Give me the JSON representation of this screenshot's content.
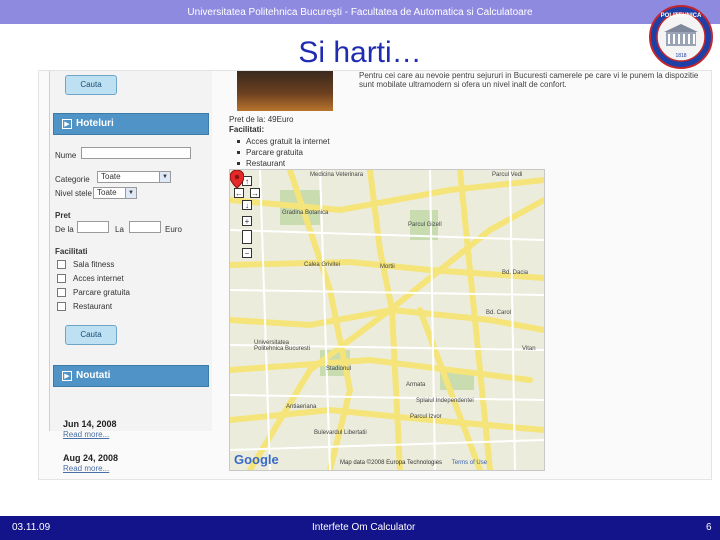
{
  "slide": {
    "header_text": "Universitatea Politehnica Bucureşti - Facultatea de Automatica si Calculatoare",
    "title": "Si harti…",
    "logo_text_top": "POLITEHNICA",
    "logo_year": "1818",
    "footer_date": "03.11.09",
    "footer_center": "Interfete Om Calculator",
    "footer_page": "6"
  },
  "sidebar": {
    "search_button_top": "Cauta",
    "hotels_panel_title": "Hoteluri",
    "name_label": "Nume",
    "category_label": "Categorie",
    "category_value": "Toate",
    "level_label": "Nivel stele",
    "level_value": "Toate",
    "price_heading": "Pret",
    "price_from_label": "De la",
    "price_to_label": "La",
    "price_currency": "Euro",
    "facilities_heading": "Facilitati",
    "facilities": [
      "Sala fitness",
      "Acces internet",
      "Parcare gratuita",
      "Restaurant"
    ],
    "search_button": "Cauta",
    "news_panel_title": "Noutati",
    "news": [
      {
        "date": "Jun 14, 2008",
        "link": "Read more..."
      },
      {
        "date": "Aug 24, 2008",
        "link": "Read more..."
      }
    ]
  },
  "hotel": {
    "description": "Pentru cei care au nevoie pentru sejururi in Bucuresti camerele pe care vi le punem la dispozitie sunt mobilate ultramodern si ofera un nivel inalt de confort.",
    "price_label": "Pret de la:",
    "price_value": "49Euro",
    "facilities_title": "Facilitati:",
    "facilities": [
      "Acces gratuit la internet",
      "Parcare gratuita",
      "Restaurant"
    ]
  },
  "map": {
    "labels": {
      "medicina": "Medicina Veterinara",
      "parcul_vedi": "Parcul Vedi",
      "gradina": "Gradina Botanica",
      "parcul_gizell": "Parcul Gizell",
      "calea_grivitei": "Calea Grivitei",
      "mortii": "Mortii",
      "bd_dacia": "Bd. Dacia",
      "bd_carol": "Bd. Carol",
      "vitan": "Vitan",
      "universitatea": "Universitatea Politehnica Bucuresti",
      "stadionul": "Stadionul",
      "armata": "Armata",
      "splaiul": "Splaiul Independentei",
      "parcul_izvor": "Parcul Izvor",
      "bd_libertatii": "Bulevardul Libertatii",
      "antiaeriana": "Antiaeriana"
    },
    "copyright": "Map data ©2008 Europa Technologies",
    "terms": "Terms of Use",
    "google": "Google",
    "zoom_in": "+",
    "zoom_out": "−"
  },
  "colors": {
    "header_bar": "#8e8ae0",
    "title": "#1f2bb0",
    "footer_bar": "#13138a",
    "panel_head": "#4f93c7",
    "button_fill": "#bde0f2",
    "road_major": "#f5e47a",
    "map_base": "#ececdc",
    "pin": "#e22a2a"
  }
}
